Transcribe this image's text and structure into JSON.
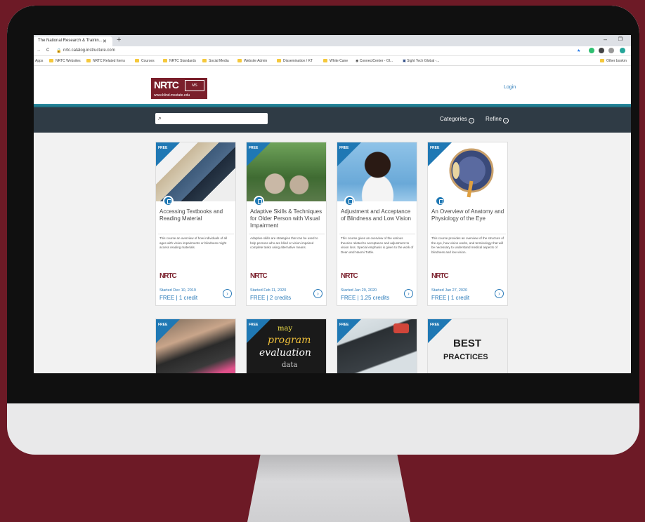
{
  "browser": {
    "tab_title": "The National Research & Trainin...",
    "url": "nrtc.catalog.instructure.com",
    "bookmarks": [
      "Apps",
      "NRTC Websites",
      "NRTC Related Items",
      "Courses",
      "NRTC Standards",
      "Social Media",
      "Website Admin",
      "Dissemination / KT",
      "White Cane",
      "ConnectCenter - Ol...",
      "Sight Tech Global -..."
    ],
    "other_bookmarks": "Other bookm"
  },
  "site": {
    "logo_text": "NRTC",
    "logo_url": "www.blind.msstate.edu",
    "login": "Login",
    "search_placeholder": "",
    "categories": "Categories",
    "refine": "Refine"
  },
  "colors": {
    "brand": "#7a1f2b",
    "accent": "#1f78b4",
    "nav": "#2f3b45"
  },
  "courses": [
    {
      "badge": "FREE",
      "title": "Accessing Textbooks and Reading Material",
      "description": "This course an overview of how individuals of all ages with vision impairments or blindness might access reading materials.",
      "org": "NRTC",
      "started": "Started Dec 10, 2019",
      "price": "FREE | 1 credit"
    },
    {
      "badge": "FREE",
      "title": "Adaptive Skills & Techniques for Older Person with Visual Impairment",
      "description": "Adaptive skills are strategies that can be used to help persons who are blind or vision impaired complete tasks using alternative means.",
      "org": "NRTC",
      "started": "Started Feb 11, 2020",
      "price": "FREE | 2 credits"
    },
    {
      "badge": "FREE",
      "title": "Adjustment and Acceptance of Blindness and Low Vision",
      "description": "This course gives an overview of the various theories related to acceptance and adjustment to vision loss. Special emphasis is given to the work of Dean and Naomi Tuttle.",
      "org": "NRTC",
      "started": "Started Jan 29, 2020",
      "price": "FREE | 1.25 credits"
    },
    {
      "badge": "FREE",
      "title": "An Overview of Anatomy and Physiology of the Eye",
      "description": "This course provides an overview of the structure of the eye, how vision works, and terminology that will be necessary to understand medical aspects of blindness and low vision.",
      "org": "NRTC",
      "started": "Started Jan 27, 2020",
      "price": "FREE | 1 credit"
    }
  ],
  "courses_row2": [
    {
      "badge": "FREE"
    },
    {
      "badge": "FREE",
      "image_text": [
        "may",
        "program",
        "evaluation",
        "data"
      ]
    },
    {
      "badge": "FREE"
    },
    {
      "badge": "FREE",
      "image_text": [
        "BEST",
        "PRACTICES"
      ]
    }
  ]
}
